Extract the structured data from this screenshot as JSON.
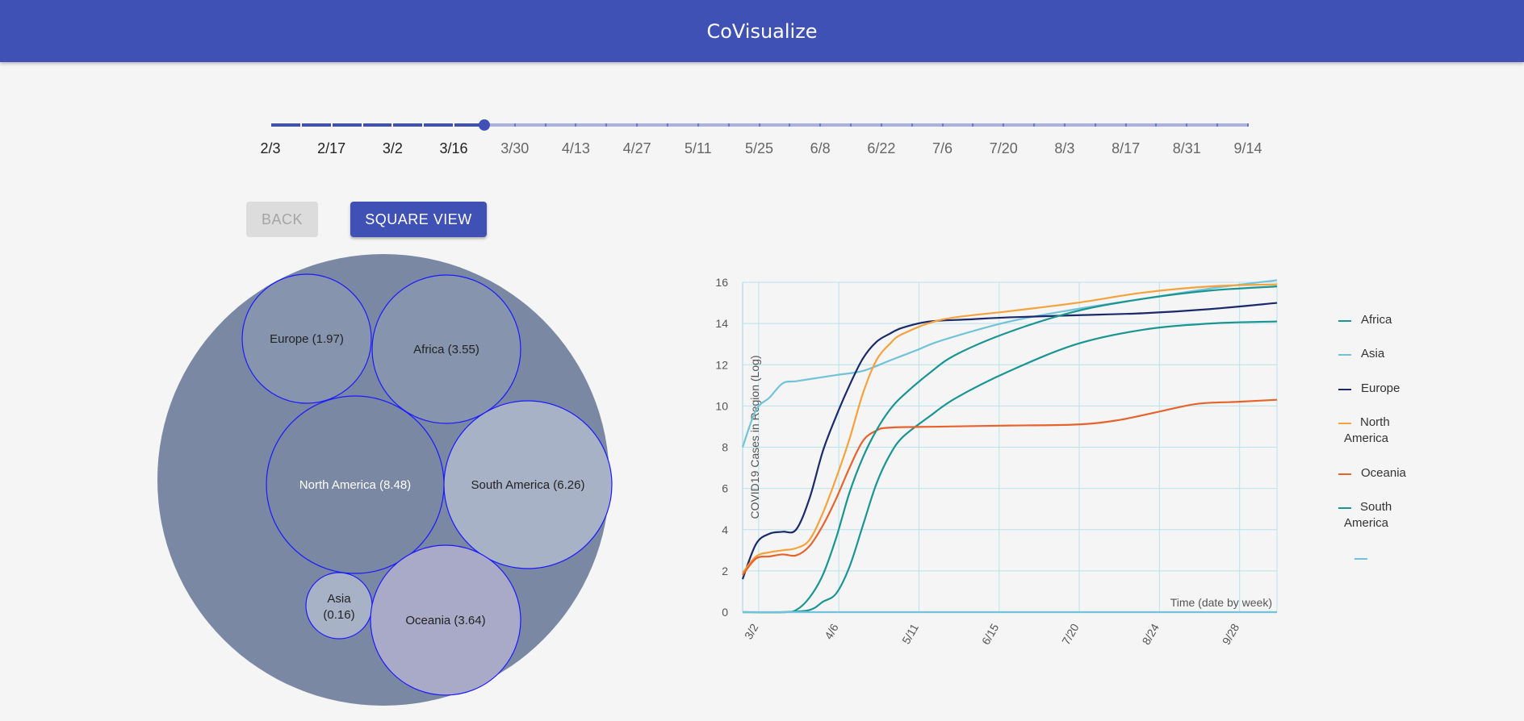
{
  "app": {
    "title": "CoVisualize"
  },
  "slider": {
    "labels": [
      "2/3",
      "2/17",
      "3/2",
      "3/16",
      "3/30",
      "4/13",
      "4/27",
      "5/11",
      "5/25",
      "6/8",
      "6/22",
      "7/6",
      "7/20",
      "8/3",
      "8/17",
      "8/31",
      "9/14"
    ],
    "selected_index": 3.5
  },
  "buttons": {
    "back": "BACK",
    "square_view": "SQUARE VIEW"
  },
  "bubbles": {
    "items": [
      {
        "name": "Europe",
        "label": "Europe (1.97)",
        "value": 1.97,
        "color": "#8794ae"
      },
      {
        "name": "Africa",
        "label": "Africa (3.55)",
        "value": 3.55,
        "color": "#8794ae"
      },
      {
        "name": "North America",
        "label": "North America (8.48)",
        "value": 8.48,
        "color": "#7a88a4"
      },
      {
        "name": "South America",
        "label": "South America (6.26)",
        "value": 6.26,
        "color": "#a8b2c7"
      },
      {
        "name": "Asia",
        "label": "Asia (0.16)",
        "label_lines": [
          "Asia",
          "(0.16)"
        ],
        "value": 0.16,
        "color": "#a8b2c7"
      },
      {
        "name": "Oceania",
        "label": "Oceania (3.64)",
        "value": 3.64,
        "color": "#a9aac8"
      }
    ],
    "outer_color": "#7a88a4",
    "stroke": "#1a1aff"
  },
  "chart_data": {
    "type": "line",
    "ylabel": "COVID19 Cases in Region (Log)",
    "xlabel": "Time (date by week)",
    "y_ticks": [
      0,
      2,
      4,
      6,
      8,
      10,
      12,
      14,
      16
    ],
    "ylim": [
      0,
      16
    ],
    "x_ticks": [
      "3/2",
      "4/6",
      "5/11",
      "6/15",
      "7/20",
      "8/24",
      "9/28"
    ],
    "grid": true,
    "legend_position": "right",
    "series": [
      {
        "name": "Africa",
        "color": "#1a9593",
        "points": [
          [
            0,
            0
          ],
          [
            3,
            0
          ],
          [
            5,
            0.1
          ],
          [
            6,
            0.5
          ],
          [
            7,
            0.9
          ],
          [
            8,
            2.2
          ],
          [
            9,
            4.2
          ],
          [
            10,
            6.2
          ],
          [
            11,
            7.6
          ],
          [
            12,
            8.5
          ],
          [
            14,
            9.5
          ],
          [
            16,
            10.4
          ],
          [
            20,
            11.7
          ],
          [
            25,
            13.0
          ],
          [
            30,
            13.7
          ],
          [
            35,
            14.0
          ],
          [
            40,
            14.1
          ]
        ]
      },
      {
        "name": "Asia",
        "color": "#72c3d9",
        "points": [
          [
            0,
            8
          ],
          [
            1,
            9.8
          ],
          [
            2,
            10.4
          ],
          [
            3,
            11.1
          ],
          [
            4,
            11.2
          ],
          [
            5,
            11.3
          ],
          [
            7,
            11.5
          ],
          [
            9,
            11.7
          ],
          [
            11,
            12.2
          ],
          [
            13,
            12.7
          ],
          [
            15,
            13.2
          ],
          [
            20,
            14.1
          ],
          [
            25,
            14.7
          ],
          [
            30,
            15.2
          ],
          [
            35,
            15.7
          ],
          [
            40,
            16.1
          ]
        ]
      },
      {
        "name": "Europe",
        "color": "#1a2a6c",
        "points": [
          [
            0,
            1.6
          ],
          [
            1,
            3.3
          ],
          [
            2,
            3.8
          ],
          [
            3,
            3.9
          ],
          [
            4,
            4.0
          ],
          [
            5,
            5.5
          ],
          [
            6,
            7.8
          ],
          [
            7,
            9.5
          ],
          [
            8,
            11.0
          ],
          [
            9,
            12.3
          ],
          [
            10,
            13.1
          ],
          [
            11,
            13.5
          ],
          [
            12,
            13.8
          ],
          [
            14,
            14.1
          ],
          [
            17,
            14.2
          ],
          [
            20,
            14.3
          ],
          [
            25,
            14.4
          ],
          [
            30,
            14.5
          ],
          [
            35,
            14.7
          ],
          [
            40,
            15.0
          ]
        ]
      },
      {
        "name": "North America",
        "color": "#f4a23b",
        "points": [
          [
            0,
            1.9
          ],
          [
            1,
            2.7
          ],
          [
            2,
            2.9
          ],
          [
            3,
            3.0
          ],
          [
            4,
            3.1
          ],
          [
            5,
            3.5
          ],
          [
            6,
            4.8
          ],
          [
            7,
            6.5
          ],
          [
            8,
            8.4
          ],
          [
            9,
            10.6
          ],
          [
            10,
            12.2
          ],
          [
            11,
            13.0
          ],
          [
            12,
            13.5
          ],
          [
            15,
            14.2
          ],
          [
            20,
            14.6
          ],
          [
            25,
            15.0
          ],
          [
            30,
            15.5
          ],
          [
            35,
            15.8
          ],
          [
            40,
            15.9
          ]
        ]
      },
      {
        "name": "Oceania",
        "color": "#e8622b",
        "points": [
          [
            0,
            1.8
          ],
          [
            1,
            2.6
          ],
          [
            2,
            2.7
          ],
          [
            3,
            2.8
          ],
          [
            4,
            2.75
          ],
          [
            5,
            3.2
          ],
          [
            6,
            4.2
          ],
          [
            7,
            5.5
          ],
          [
            8,
            7.0
          ],
          [
            9,
            8.3
          ],
          [
            10,
            8.8
          ],
          [
            11,
            8.95
          ],
          [
            15,
            9.0
          ],
          [
            20,
            9.05
          ],
          [
            25,
            9.1
          ],
          [
            28,
            9.3
          ],
          [
            31,
            9.7
          ],
          [
            34,
            10.1
          ],
          [
            37,
            10.2
          ],
          [
            40,
            10.3
          ]
        ]
      },
      {
        "name": "South America",
        "color": "#1a9593",
        "points": [
          [
            0,
            0
          ],
          [
            3,
            0
          ],
          [
            4,
            0.1
          ],
          [
            5,
            0.7
          ],
          [
            6,
            1.8
          ],
          [
            7,
            3.6
          ],
          [
            8,
            5.8
          ],
          [
            9,
            7.5
          ],
          [
            10,
            8.8
          ],
          [
            11,
            9.8
          ],
          [
            12,
            10.5
          ],
          [
            14,
            11.6
          ],
          [
            16,
            12.5
          ],
          [
            20,
            13.6
          ],
          [
            25,
            14.6
          ],
          [
            30,
            15.2
          ],
          [
            35,
            15.6
          ],
          [
            40,
            15.8
          ]
        ]
      },
      {
        "name": "",
        "color": "#72c3d9",
        "points": [
          [
            0,
            0
          ],
          [
            40,
            0
          ]
        ]
      }
    ],
    "x_tick_positions": [
      1.2,
      7.2,
      13.2,
      19.2,
      25.2,
      31.2,
      37.2
    ],
    "x_range": [
      0,
      40
    ]
  }
}
